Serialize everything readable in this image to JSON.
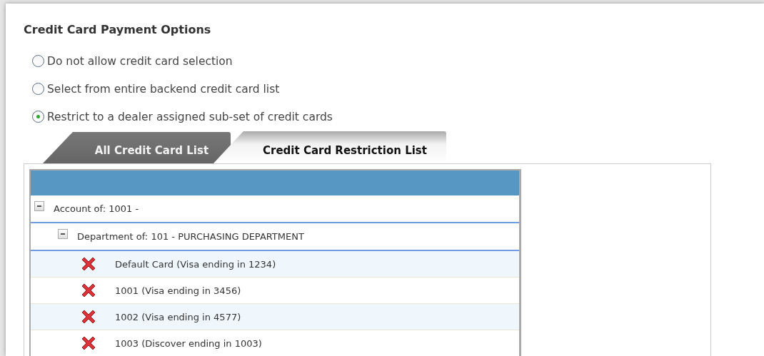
{
  "title": "Credit Card Payment Options",
  "options": [
    {
      "label": "Do not allow credit card selection",
      "selected": false
    },
    {
      "label": "Select from entire backend credit card list",
      "selected": false
    },
    {
      "label": "Restrict to a dealer assigned sub-set of credit cards",
      "selected": true
    }
  ],
  "tabs": [
    {
      "label": "All Credit Card List",
      "selected": false
    },
    {
      "label": "Credit Card Restriction List",
      "selected": true
    }
  ],
  "tree": [
    {
      "label": "Account of: 1001 -",
      "expanded": true,
      "children": [
        {
          "label": "Department of: 101 - PURCHASING DEPARTMENT",
          "expanded": true,
          "children": [
            {
              "label": "Default Card (Visa ending in 1234)"
            },
            {
              "label": "1001 (Visa ending in 3456)"
            },
            {
              "label": "1002 (Visa ending in 4577)"
            },
            {
              "label": "1003 (Discover ending in 1003)"
            }
          ]
        }
      ]
    }
  ]
}
